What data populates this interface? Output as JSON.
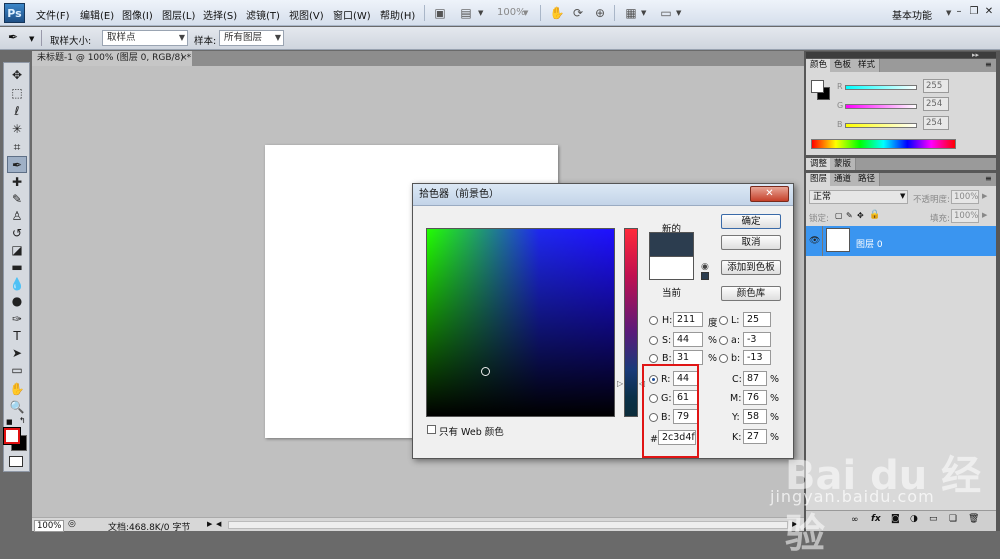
{
  "app": {
    "logo": "Ps",
    "workspace": "基本功能"
  },
  "menu": [
    "文件(F)",
    "编辑(E)",
    "图像(I)",
    "图层(L)",
    "选择(S)",
    "滤镜(T)",
    "视图(V)",
    "窗口(W)",
    "帮助(H)"
  ],
  "menubar": {
    "zoom": "100%"
  },
  "options": {
    "sample_size_label": "取样大小:",
    "sample_size_value": "取样点",
    "sample_label": "样本:",
    "sample_value": "所有图层"
  },
  "document": {
    "tab_title": "未标题-1 @ 100% (图层 0, RGB/8) *",
    "tab_close": "×",
    "status_zoom": "100%",
    "status_doc": "文档:468.8K/0 字节"
  },
  "dialog": {
    "title": "拾色器（前景色）",
    "close": "✕",
    "label_new": "新的",
    "label_current": "当前",
    "buttons": {
      "ok": "确定",
      "cancel": "取消",
      "add_swatch": "添加到色板",
      "libraries": "颜色库"
    },
    "hsb": [
      {
        "label": "H:",
        "value": "211",
        "unit": "度"
      },
      {
        "label": "S:",
        "value": "44",
        "unit": "%"
      },
      {
        "label": "B:",
        "value": "31",
        "unit": "%"
      }
    ],
    "rgb": [
      {
        "label": "R:",
        "value": "44"
      },
      {
        "label": "G:",
        "value": "61"
      },
      {
        "label": "B:",
        "value": "79"
      }
    ],
    "lab": [
      {
        "label": "L:",
        "value": "25"
      },
      {
        "label": "a:",
        "value": "-3"
      },
      {
        "label": "b:",
        "value": "-13"
      }
    ],
    "cmyk": [
      {
        "label": "C:",
        "value": "87",
        "unit": "%"
      },
      {
        "label": "M:",
        "value": "76",
        "unit": "%"
      },
      {
        "label": "Y:",
        "value": "58",
        "unit": "%"
      },
      {
        "label": "K:",
        "value": "27",
        "unit": "%"
      }
    ],
    "hex_label": "#",
    "hex_value": "2c3d4f",
    "web_only": "只有 Web 颜色",
    "new_color": "#2c3d4f",
    "current_color": "#ffffff"
  },
  "panels": {
    "color_tabs": [
      "颜色",
      "色板",
      "样式"
    ],
    "color_values": [
      "255",
      "254",
      "254"
    ],
    "adj_tabs": [
      "调整",
      "蒙版"
    ],
    "layers_tabs": [
      "图层",
      "通道",
      "路径"
    ],
    "blend_mode": "正常",
    "opacity_label": "不透明度:",
    "opacity_value": "100%",
    "lock_label": "锁定:",
    "fill_label": "填充:",
    "fill_value": "100%",
    "layer_name": "图层 0"
  },
  "watermark": {
    "brand": "Bai du 经验",
    "url": "jingyan.baidu.com"
  }
}
